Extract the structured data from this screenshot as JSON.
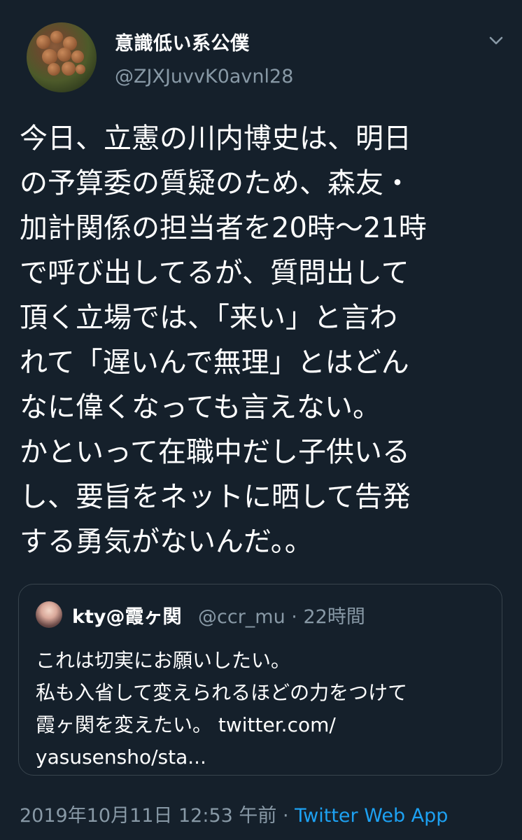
{
  "author": {
    "display_name": "意識低い系公僕",
    "handle": "@ZJXJuvvK0avnl28"
  },
  "tweet": {
    "text": "今日、立憲の川内博史は、明日\nの予算委の質疑のため、森友・\n加計関係の担当者を20時〜21時\nで呼び出してるが、質問出して\n頂く立場では、「来い」と言わ\nれて「遅いんで無理」とはどん\nなに偉くなっても言えない。\nかといって在職中だし子供いる\nし、要旨をネットに晒して告発\nする勇気がないんだ。。"
  },
  "quote": {
    "name": "kty@霞ヶ関",
    "handle": "@ccr_mu",
    "separator": " · ",
    "time": "22時間",
    "text": "これは切実にお願いしたい。\n私も入省して変えられるほどの力をつけて\n霞ヶ関を変えたい。 twitter.com/\nyasusensho/sta..."
  },
  "footer": {
    "timestamp": "2019年10月11日 12:53 午前",
    "separator": " · ",
    "source": "Twitter Web App"
  },
  "icons": {
    "caret": "chevron-down-icon"
  },
  "colors": {
    "background": "#15202b",
    "secondary_text": "#8899a6",
    "link": "#1da1f2",
    "border": "#38444d"
  }
}
